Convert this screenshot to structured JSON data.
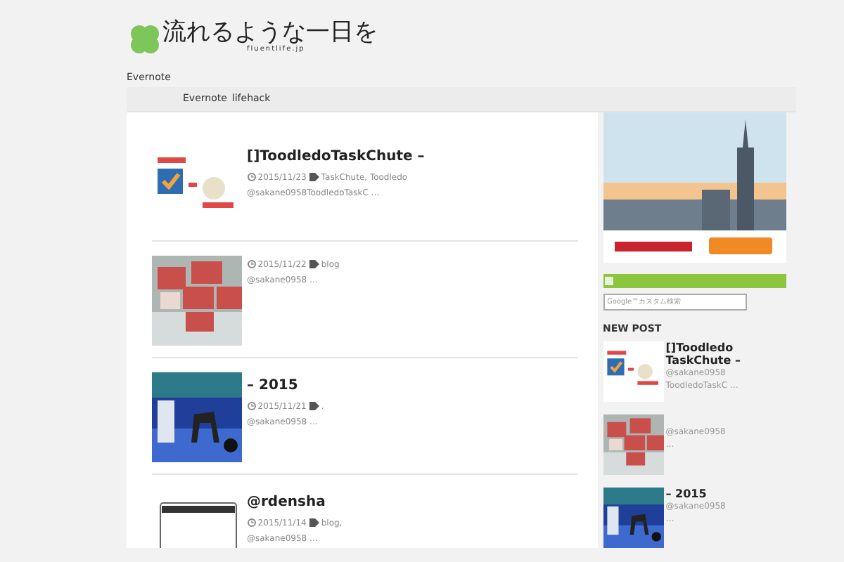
{
  "logo": {
    "title": "流れるような一日を",
    "subtitle": "fluentlife.jp"
  },
  "tagline": "Evernote",
  "nav": [
    {
      "label": "Evernote"
    },
    {
      "label": "lifehack"
    }
  ],
  "posts": [
    {
      "title": "[]ToodledoTaskChute –",
      "date": "2015/11/23",
      "tags": "TaskChute, Toodledo",
      "excerpt": "@sakane0958ToodledoTaskC …"
    },
    {
      "date": "2015/11/22",
      "tags": "blog",
      "excerpt": "@sakane0958 …"
    },
    {
      "title": "– 2015",
      "date": "2015/11/21",
      "tags": ".",
      "excerpt": "@sakane0958 …"
    },
    {
      "title": "@rdensha",
      "date": "2015/11/14",
      "tags": "blog,",
      "excerpt": "@sakane0958 …"
    }
  ],
  "sidebar": {
    "search": {
      "placeholder": "Google™カスタム検索"
    },
    "heading": "NEW POST",
    "items": [
      {
        "title": "[]Toodledo TaskChute –",
        "lines": [
          "@sakane0958",
          "ToodledoTaskC …"
        ]
      },
      {
        "lines": [
          "@sakane0958",
          "…"
        ]
      },
      {
        "title": "– 2015",
        "lines": [
          "@sakane0958",
          "…"
        ]
      }
    ]
  }
}
